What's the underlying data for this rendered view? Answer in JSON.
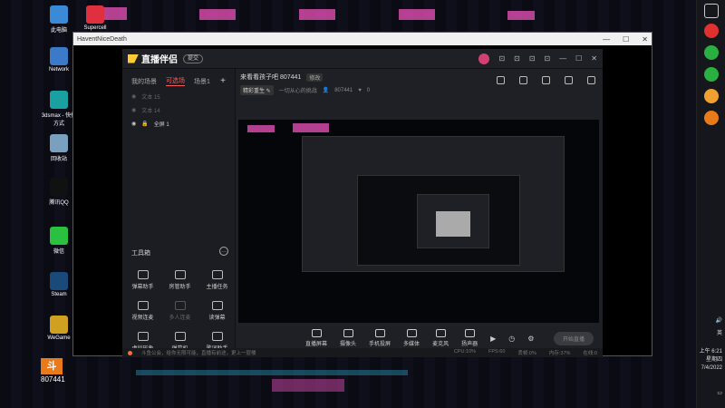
{
  "desktop": {
    "icons": [
      {
        "label": "此电脑",
        "color": "#3a8ad8"
      },
      {
        "label": "Network",
        "color": "#3a7ac8"
      },
      {
        "label": "3dsmax - 快捷方式",
        "color": "#1aa0a0"
      },
      {
        "label": "回收站",
        "color": "#7aa0c0"
      },
      {
        "label": "腾讯QQ",
        "color": "#111111"
      },
      {
        "label": "微信",
        "color": "#2ac040"
      },
      {
        "label": "Steam",
        "color": "#1a4a7a"
      },
      {
        "label": "WeGame",
        "color": "#d0a020"
      }
    ],
    "top_icon_label": "Supercell",
    "stream_logo_text": "斗鱼 ID",
    "stream_id": "807441"
  },
  "taskbar": {
    "time": "上午 6:21",
    "weekday": "星期四",
    "date": "7/4/2022",
    "lang": "英",
    "colors": [
      "#e03030",
      "#2ab040",
      "#2ab040",
      "#f0a030",
      "#e87a1a"
    ]
  },
  "window": {
    "title": "HaventNiceDeath",
    "controls": [
      "—",
      "☐",
      "✕"
    ]
  },
  "app": {
    "logo": "直播伴侣",
    "badge": "提交",
    "header_icons": [
      "⊡",
      "⊡",
      "⊡",
      "⊡",
      "—",
      "☐",
      "✕"
    ],
    "sidebar": {
      "tabs": [
        "我的场景",
        "可选场",
        "场景1"
      ],
      "sources": [
        {
          "label": "文本 15",
          "on": false
        },
        {
          "label": "文本 14",
          "on": false
        },
        {
          "label": "全屏 1",
          "on": true
        }
      ],
      "tools_header": "工具箱",
      "tools": [
        {
          "label": "弹幕助手",
          "dim": false
        },
        {
          "label": "房管助手",
          "dim": false
        },
        {
          "label": "主播任务",
          "dim": false
        },
        {
          "label": "视频连麦",
          "dim": false
        },
        {
          "label": "多人连麦",
          "dim": true
        },
        {
          "label": "读弹幕",
          "dim": false
        },
        {
          "label": "虚拟形象",
          "dim": false
        },
        {
          "label": "弹幕机",
          "dim": false
        },
        {
          "label": "歌词助手",
          "dim": false
        }
      ]
    },
    "room": {
      "title": "来看看孩子吧 807441",
      "edit": "修改",
      "meta_chip": "精彩重生 ✎",
      "meta_text": "一切从心的挑战",
      "room_id": "807441",
      "likes": "0"
    },
    "bottom_bar": [
      {
        "label": "直播屏幕"
      },
      {
        "label": "摄像头"
      },
      {
        "label": "手机投屏"
      },
      {
        "label": "多媒体"
      },
      {
        "label": "麦克风"
      },
      {
        "label": "扬声器"
      }
    ],
    "start_button": "开始直播",
    "status": {
      "left": "斗鱼公会，给你无限可能，直播有前途，更上一层楼",
      "right": [
        "CPU:10%",
        "FPS:60",
        "丢帧:0%",
        "内存:37%",
        "在线:0"
      ]
    }
  }
}
